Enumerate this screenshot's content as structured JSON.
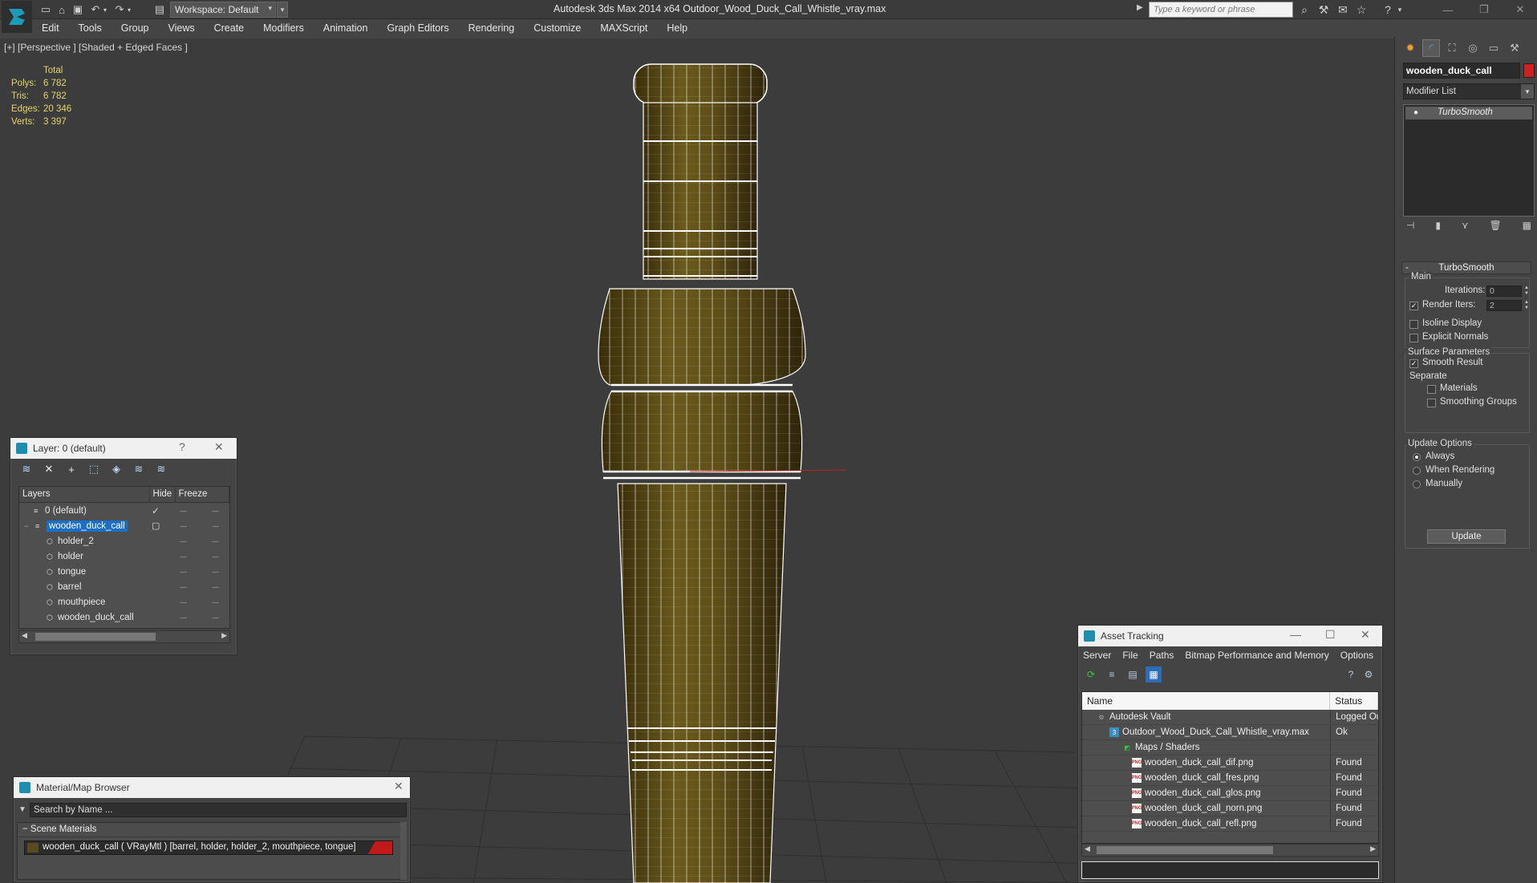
{
  "titlebar": {
    "workspace": "Workspace: Default",
    "title": "Autodesk 3ds Max  2014 x64     Outdoor_Wood_Duck_Call_Whistle_vray.max",
    "search_placeholder": "Type a keyword or phrase"
  },
  "menu": [
    "Edit",
    "Tools",
    "Group",
    "Views",
    "Create",
    "Modifiers",
    "Animation",
    "Graph Editors",
    "Rendering",
    "Customize",
    "MAXScript",
    "Help"
  ],
  "viewport": {
    "label": "[+] [Perspective ] [Shaded + Edged Faces ]",
    "stats": {
      "header": "Total",
      "rows": [
        {
          "k": "Polys:",
          "v": "6 782"
        },
        {
          "k": "Tris:",
          "v": "6 782"
        },
        {
          "k": "Edges:",
          "v": "20 346"
        },
        {
          "k": "Verts:",
          "v": "3 397"
        }
      ]
    },
    "model_color": "#5a4a14",
    "wire_color": "#ffffff"
  },
  "layer_panel": {
    "title": "Layer: 0 (default)",
    "help": "?",
    "columns": {
      "layers": "Layers",
      "hide": "Hide",
      "freeze": "Freeze"
    },
    "rows": [
      {
        "name": "0 (default)",
        "level": 0,
        "icon": "layer-icon",
        "checked": true
      },
      {
        "name": "wooden_duck_call",
        "level": 0,
        "icon": "layer-icon",
        "selected": true
      },
      {
        "name": "holder_2",
        "level": 1,
        "icon": "object-icon"
      },
      {
        "name": "holder",
        "level": 1,
        "icon": "object-icon"
      },
      {
        "name": "tongue",
        "level": 1,
        "icon": "object-icon"
      },
      {
        "name": "barrel",
        "level": 1,
        "icon": "object-icon"
      },
      {
        "name": "mouthpiece",
        "level": 1,
        "icon": "object-icon"
      },
      {
        "name": "wooden_duck_call",
        "level": 1,
        "icon": "object-icon"
      }
    ],
    "hide_mark": "----",
    "freeze_mark": "----"
  },
  "material_browser": {
    "title": "Material/Map Browser",
    "search_placeholder": "Search by Name ...",
    "section": "Scene Materials",
    "item": "wooden_duck_call  ( VRayMtl )  [barrel, holder, holder_2, mouthpiece, tongue]"
  },
  "asset_tracking": {
    "title": "Asset Tracking",
    "menu": [
      "Server",
      "File",
      "Paths",
      "Bitmap Performance and Memory",
      "Options"
    ],
    "columns": {
      "name": "Name",
      "status": "Status"
    },
    "rows": [
      {
        "name": "Autodesk Vault",
        "status": "Logged Ou",
        "indent": 1,
        "icon": "vault"
      },
      {
        "name": "Outdoor_Wood_Duck_Call_Whistle_vray.max",
        "status": "Ok",
        "indent": 2,
        "icon": "max"
      },
      {
        "name": "Maps / Shaders",
        "status": "",
        "indent": 3,
        "icon": "maps"
      },
      {
        "name": "wooden_duck_call_dif.png",
        "status": "Found",
        "indent": 4,
        "icon": "png"
      },
      {
        "name": "wooden_duck_call_fres.png",
        "status": "Found",
        "indent": 4,
        "icon": "png"
      },
      {
        "name": "wooden_duck_call_glos.png",
        "status": "Found",
        "indent": 4,
        "icon": "png"
      },
      {
        "name": "wooden_duck_call_norn.png",
        "status": "Found",
        "indent": 4,
        "icon": "png"
      },
      {
        "name": "wooden_duck_call_refl.png",
        "status": "Found",
        "indent": 4,
        "icon": "png"
      }
    ]
  },
  "command_panel": {
    "object_name": "wooden_duck_call",
    "object_color": "#cc2222",
    "modifier_list": "Modifier List",
    "stack_item": "TurboSmooth",
    "rollout_title": "TurboSmooth",
    "main_label": "Main",
    "iterations_label": "Iterations:",
    "iterations_value": "0",
    "render_iters_label": "Render Iters:",
    "render_iters_value": "2",
    "isoline_label": "Isoline Display",
    "explicit_normals_label": "Explicit Normals",
    "surface_params_label": "Surface Parameters",
    "smooth_result_label": "Smooth Result",
    "separate_label": "Separate",
    "materials_label": "Materials",
    "smoothing_groups_label": "Smoothing Groups",
    "update_options_label": "Update Options",
    "always_label": "Always",
    "when_rendering_label": "When Rendering",
    "manually_label": "Manually",
    "update_button": "Update"
  }
}
